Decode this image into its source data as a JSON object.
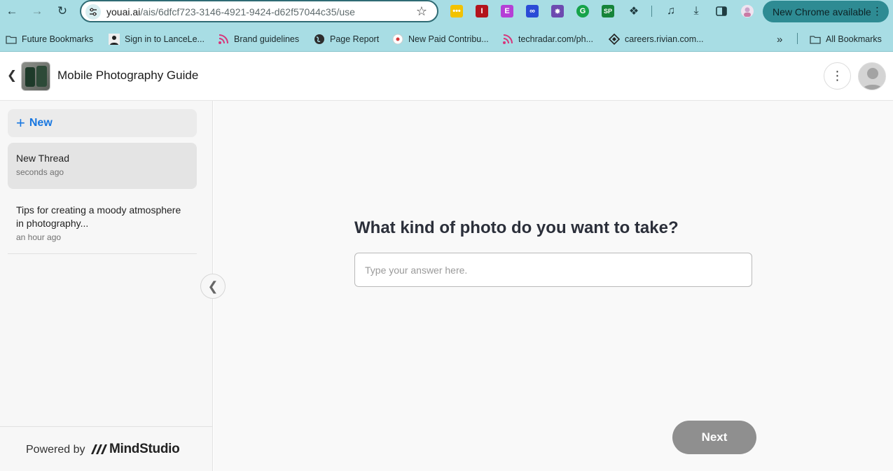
{
  "browser": {
    "url_host": "youai.ai",
    "url_path": "/ais/6dfcf723-3146-4921-9424-d62f57044c35/use",
    "update_label": "New Chrome available",
    "extensions": [
      {
        "name": "ext-yellow",
        "glyph": "•••",
        "color": "#f2c200"
      },
      {
        "name": "ext-red",
        "glyph": "I",
        "color": "#b3141c"
      },
      {
        "name": "ext-purple",
        "glyph": "E",
        "color": "#b53fd6"
      },
      {
        "name": "ext-link",
        "glyph": "∞",
        "color": "#2a4bd6"
      },
      {
        "name": "ext-asterisk",
        "glyph": "✸",
        "color": "#6d4ab0"
      },
      {
        "name": "ext-grammarly",
        "glyph": "G",
        "color": "#16a34a"
      },
      {
        "name": "ext-sp",
        "glyph": "SP",
        "color": "#16843a"
      }
    ]
  },
  "bookmarks": {
    "items": [
      {
        "label": "Future Bookmarks",
        "icon": "folder-icon"
      },
      {
        "label": "Sign in to LanceLe...",
        "icon": "person-icon"
      },
      {
        "label": "Brand guidelines",
        "icon": "rss-icon"
      },
      {
        "label": "Page Report",
        "icon": "globe-icon"
      },
      {
        "label": "New Paid Contribu...",
        "icon": "record-icon"
      },
      {
        "label": "techradar.com/ph...",
        "icon": "rss-icon"
      },
      {
        "label": "careers.rivian.com...",
        "icon": "diamond-icon"
      }
    ],
    "more": "»",
    "all_label": "All Bookmarks"
  },
  "app": {
    "title": "Mobile Photography Guide"
  },
  "sidebar": {
    "new_label": "New",
    "threads": [
      {
        "title": "New Thread",
        "time": "seconds ago"
      },
      {
        "title": "Tips for creating a moody atmosphere in photography...",
        "time": "an hour ago"
      }
    ],
    "powered_by": "Powered by",
    "brand": "MindStudio"
  },
  "main": {
    "question": "What kind of photo do you want to take?",
    "answer_value": "",
    "answer_placeholder": "Type your answer here.",
    "next_label": "Next"
  },
  "colors": {
    "chrome": "#a8dde4",
    "accent": "#1877e0",
    "next_disabled": "#8f8f8f"
  }
}
